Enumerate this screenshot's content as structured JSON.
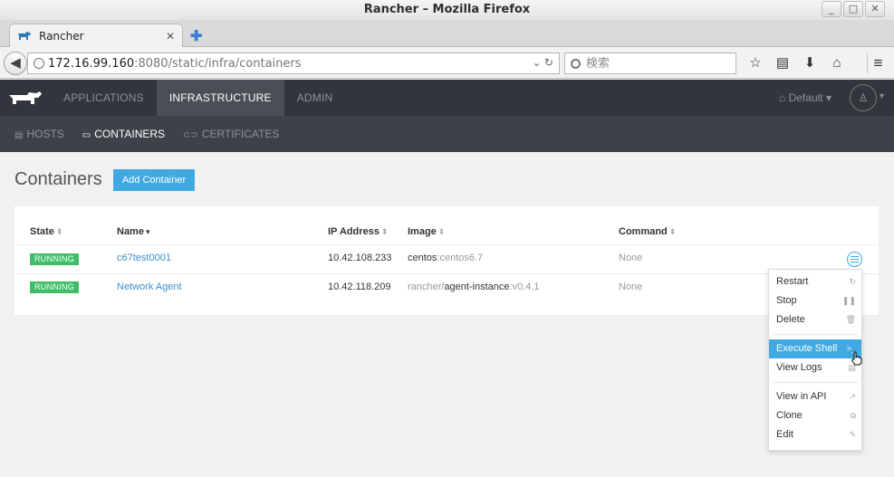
{
  "window": {
    "title": "Rancher – Mozilla Firefox"
  },
  "browser": {
    "tab_title": "Rancher",
    "url_host": "172.16.99.160",
    "url_path": ":8080/static/infra/containers",
    "search_placeholder": "検索"
  },
  "header": {
    "nav": [
      "APPLICATIONS",
      "INFRASTRUCTURE",
      "ADMIN"
    ],
    "active_nav": "INFRASTRUCTURE",
    "environment": "Default"
  },
  "subnav": {
    "hosts": "HOSTS",
    "containers": "CONTAINERS",
    "certificates": "CERTIFICATES"
  },
  "page": {
    "title": "Containers",
    "add_button": "Add Container"
  },
  "table": {
    "headers": {
      "state": "State",
      "name": "Name",
      "ip": "IP Address",
      "image": "Image",
      "command": "Command"
    },
    "rows": [
      {
        "state": "RUNNING",
        "name": "c67test0001",
        "ip": "10.42.108.233",
        "image_repo": "centos",
        "image_tag": ":centos6.7",
        "image_sub": "",
        "command": "None"
      },
      {
        "state": "RUNNING",
        "name": "Network Agent",
        "ip": "10.42.118.209",
        "image_repo": "rancher/",
        "image_sub": "agent-instance",
        "image_tag": ":v0.4.1",
        "command": "None"
      }
    ]
  },
  "menu": {
    "restart": "Restart",
    "stop": "Stop",
    "delete": "Delete",
    "execute_shell": "Execute Shell",
    "view_logs": "View Logs",
    "view_api": "View in API",
    "clone": "Clone",
    "edit": "Edit"
  },
  "colors": {
    "accent": "#40a9e2",
    "running": "#3ebf67",
    "header_bg": "#32363c"
  }
}
